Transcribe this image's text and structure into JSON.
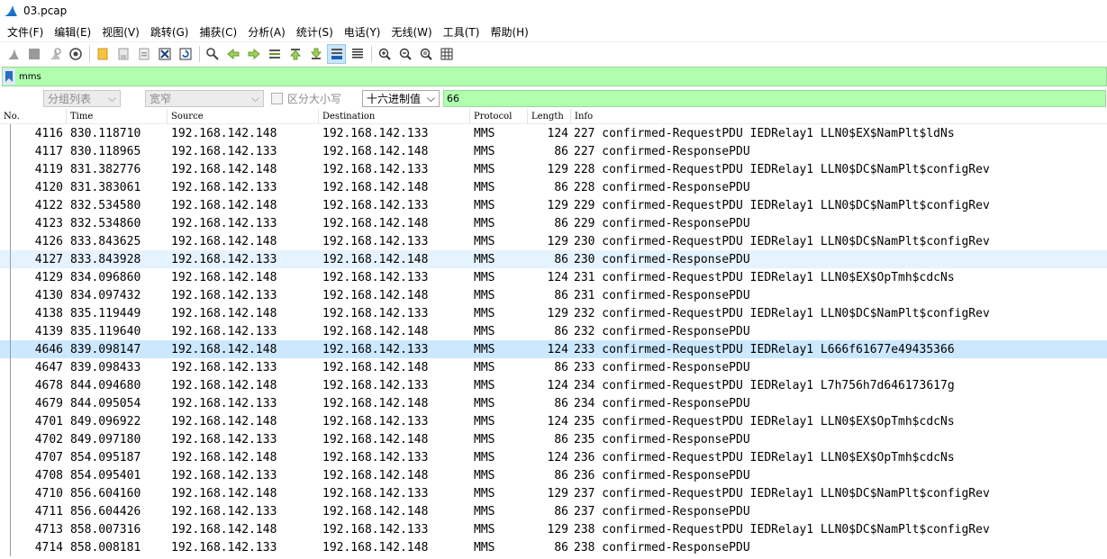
{
  "window": {
    "title": "03.pcap"
  },
  "menu": [
    "文件(F)",
    "编辑(E)",
    "视图(V)",
    "跳转(G)",
    "捕获(C)",
    "分析(A)",
    "统计(S)",
    "电话(Y)",
    "无线(W)",
    "工具(T)",
    "帮助(H)"
  ],
  "filter": {
    "value": "mms"
  },
  "search": {
    "scope": "分组列表",
    "charset": "宽窄",
    "case_label": "区分大小写",
    "type": "十六进制值",
    "value": "66"
  },
  "columns": [
    "No.",
    "Time",
    "Source",
    "Destination",
    "Protocol",
    "Length",
    "Info"
  ],
  "packets": [
    {
      "no": "4116",
      "time": "830.118710",
      "src": "192.168.142.148",
      "dst": "192.168.142.133",
      "proto": "MMS",
      "len": "124",
      "info": "227 confirmed-RequestPDU IEDRelay1 LLN0$EX$NamPlt$ldNs"
    },
    {
      "no": "4117",
      "time": "830.118965",
      "src": "192.168.142.133",
      "dst": "192.168.142.148",
      "proto": "MMS",
      "len": "86",
      "info": "227 confirmed-ResponsePDU"
    },
    {
      "no": "4119",
      "time": "831.382776",
      "src": "192.168.142.148",
      "dst": "192.168.142.133",
      "proto": "MMS",
      "len": "129",
      "info": "228 confirmed-RequestPDU IEDRelay1 LLN0$DC$NamPlt$configRev"
    },
    {
      "no": "4120",
      "time": "831.383061",
      "src": "192.168.142.133",
      "dst": "192.168.142.148",
      "proto": "MMS",
      "len": "86",
      "info": "228 confirmed-ResponsePDU"
    },
    {
      "no": "4122",
      "time": "832.534580",
      "src": "192.168.142.148",
      "dst": "192.168.142.133",
      "proto": "MMS",
      "len": "129",
      "info": "229 confirmed-RequestPDU IEDRelay1 LLN0$DC$NamPlt$configRev"
    },
    {
      "no": "4123",
      "time": "832.534860",
      "src": "192.168.142.133",
      "dst": "192.168.142.148",
      "proto": "MMS",
      "len": "86",
      "info": "229 confirmed-ResponsePDU"
    },
    {
      "no": "4126",
      "time": "833.843625",
      "src": "192.168.142.148",
      "dst": "192.168.142.133",
      "proto": "MMS",
      "len": "129",
      "info": "230 confirmed-RequestPDU IEDRelay1 LLN0$DC$NamPlt$configRev"
    },
    {
      "no": "4127",
      "time": "833.843928",
      "src": "192.168.142.133",
      "dst": "192.168.142.148",
      "proto": "MMS",
      "len": "86",
      "info": "230 confirmed-ResponsePDU",
      "state": "hover"
    },
    {
      "no": "4129",
      "time": "834.096860",
      "src": "192.168.142.148",
      "dst": "192.168.142.133",
      "proto": "MMS",
      "len": "124",
      "info": "231 confirmed-RequestPDU IEDRelay1 LLN0$EX$OpTmh$cdcNs"
    },
    {
      "no": "4130",
      "time": "834.097432",
      "src": "192.168.142.133",
      "dst": "192.168.142.148",
      "proto": "MMS",
      "len": "86",
      "info": "231 confirmed-ResponsePDU"
    },
    {
      "no": "4138",
      "time": "835.119449",
      "src": "192.168.142.148",
      "dst": "192.168.142.133",
      "proto": "MMS",
      "len": "129",
      "info": "232 confirmed-RequestPDU IEDRelay1 LLN0$DC$NamPlt$configRev"
    },
    {
      "no": "4139",
      "time": "835.119640",
      "src": "192.168.142.133",
      "dst": "192.168.142.148",
      "proto": "MMS",
      "len": "86",
      "info": "232 confirmed-ResponsePDU"
    },
    {
      "no": "4646",
      "time": "839.098147",
      "src": "192.168.142.148",
      "dst": "192.168.142.133",
      "proto": "MMS",
      "len": "124",
      "info": "233 confirmed-RequestPDU IEDRelay1 L666f61677e49435366",
      "state": "selected"
    },
    {
      "no": "4647",
      "time": "839.098433",
      "src": "192.168.142.133",
      "dst": "192.168.142.148",
      "proto": "MMS",
      "len": "86",
      "info": "233 confirmed-ResponsePDU"
    },
    {
      "no": "4678",
      "time": "844.094680",
      "src": "192.168.142.148",
      "dst": "192.168.142.133",
      "proto": "MMS",
      "len": "124",
      "info": "234 confirmed-RequestPDU IEDRelay1 L7h756h7d646173617g"
    },
    {
      "no": "4679",
      "time": "844.095054",
      "src": "192.168.142.133",
      "dst": "192.168.142.148",
      "proto": "MMS",
      "len": "86",
      "info": "234 confirmed-ResponsePDU"
    },
    {
      "no": "4701",
      "time": "849.096922",
      "src": "192.168.142.148",
      "dst": "192.168.142.133",
      "proto": "MMS",
      "len": "124",
      "info": "235 confirmed-RequestPDU IEDRelay1 LLN0$EX$OpTmh$cdcNs"
    },
    {
      "no": "4702",
      "time": "849.097180",
      "src": "192.168.142.133",
      "dst": "192.168.142.148",
      "proto": "MMS",
      "len": "86",
      "info": "235 confirmed-ResponsePDU"
    },
    {
      "no": "4707",
      "time": "854.095187",
      "src": "192.168.142.148",
      "dst": "192.168.142.133",
      "proto": "MMS",
      "len": "124",
      "info": "236 confirmed-RequestPDU IEDRelay1 LLN0$EX$OpTmh$cdcNs"
    },
    {
      "no": "4708",
      "time": "854.095401",
      "src": "192.168.142.133",
      "dst": "192.168.142.148",
      "proto": "MMS",
      "len": "86",
      "info": "236 confirmed-ResponsePDU"
    },
    {
      "no": "4710",
      "time": "856.604160",
      "src": "192.168.142.148",
      "dst": "192.168.142.133",
      "proto": "MMS",
      "len": "129",
      "info": "237 confirmed-RequestPDU IEDRelay1 LLN0$DC$NamPlt$configRev"
    },
    {
      "no": "4711",
      "time": "856.604426",
      "src": "192.168.142.133",
      "dst": "192.168.142.148",
      "proto": "MMS",
      "len": "86",
      "info": "237 confirmed-ResponsePDU"
    },
    {
      "no": "4713",
      "time": "858.007316",
      "src": "192.168.142.148",
      "dst": "192.168.142.133",
      "proto": "MMS",
      "len": "129",
      "info": "238 confirmed-RequestPDU IEDRelay1 LLN0$DC$NamPlt$configRev"
    },
    {
      "no": "4714",
      "time": "858.008181",
      "src": "192.168.142.133",
      "dst": "192.168.142.148",
      "proto": "MMS",
      "len": "86",
      "info": "238 confirmed-ResponsePDU"
    }
  ],
  "colors": {
    "filter_bg": "#afffaf",
    "selected_row": "#cce8ff",
    "hover_row": "#e5f3ff",
    "app_logo": "#1a73c9"
  }
}
